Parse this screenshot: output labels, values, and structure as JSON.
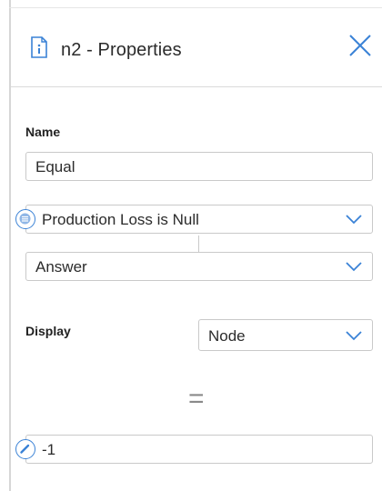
{
  "header": {
    "title": "n2 - Properties",
    "icon": "info-document-icon",
    "close_icon": "close-icon"
  },
  "name_section": {
    "label": "Name",
    "value": "Equal"
  },
  "condition": {
    "selected": "Production Loss is Null",
    "badge_icon": "list-icon"
  },
  "answer": {
    "selected": "Answer"
  },
  "display_section": {
    "label": "Display",
    "selected": "Node"
  },
  "operator": {
    "symbol": "="
  },
  "value_field": {
    "value": "-1",
    "badge_icon": "edit-icon"
  },
  "colors": {
    "accent": "#3a82d6",
    "border": "#c9c9c9",
    "text": "#2b2b2b"
  }
}
